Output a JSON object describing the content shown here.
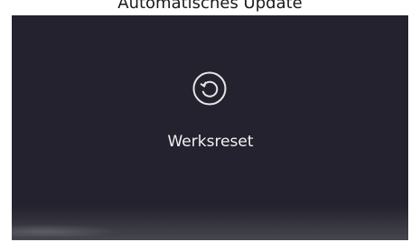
{
  "header": {
    "caption": "Automatisches Update"
  },
  "screen": {
    "background_color": "#23222e",
    "reset_tile": {
      "icon": "reset-icon",
      "label": "Werksreset"
    }
  }
}
